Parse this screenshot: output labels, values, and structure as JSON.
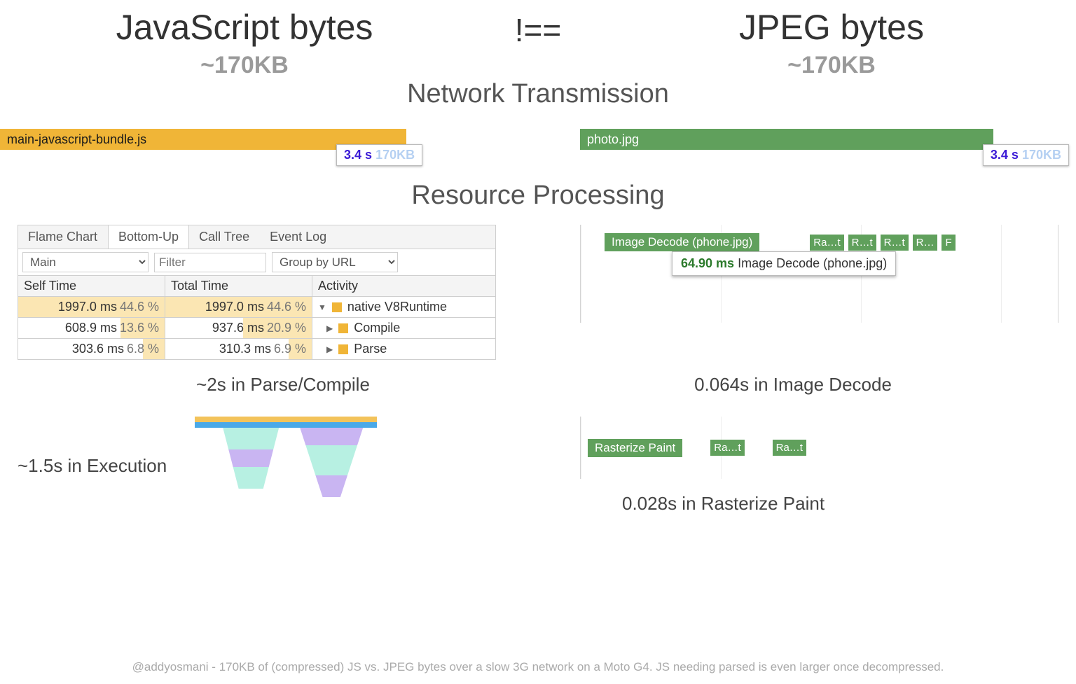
{
  "titles": {
    "left": "JavaScript bytes",
    "notequal": "!==",
    "right": "JPEG bytes",
    "size_left": "~170KB",
    "size_right": "~170KB"
  },
  "sections": {
    "network": "Network Transmission",
    "processing": "Resource Processing"
  },
  "network": {
    "left_file": "main-javascript-bundle.js",
    "right_file": "photo.jpg",
    "badge_left": {
      "time": "3.4 s",
      "size": "170KB"
    },
    "badge_right": {
      "time": "3.4 s",
      "size": "170KB"
    }
  },
  "bottom_up": {
    "tabs": [
      "Flame Chart",
      "Bottom-Up",
      "Call Tree",
      "Event Log"
    ],
    "active_tab": "Bottom-Up",
    "main_select": "Main",
    "filter_placeholder": "Filter",
    "group_by": "Group by URL",
    "columns": [
      "Self Time",
      "Total Time",
      "Activity"
    ],
    "rows": [
      {
        "self_ms": "1997.0 ms",
        "self_pct": "44.6 %",
        "self_bar": 100,
        "total_ms": "1997.0 ms",
        "total_pct": "44.6 %",
        "total_bar": 100,
        "tri": "▼",
        "activity": "native V8Runtime"
      },
      {
        "self_ms": "608.9 ms",
        "self_pct": "13.6 %",
        "self_bar": 30,
        "total_ms": "937.6 ms",
        "total_pct": "20.9 %",
        "total_bar": 47,
        "tri": "▶",
        "activity": "Compile"
      },
      {
        "self_ms": "303.6 ms",
        "self_pct": "6.8 %",
        "self_bar": 15,
        "total_ms": "310.3 ms",
        "total_pct": "6.9 %",
        "total_bar": 16,
        "tri": "▶",
        "activity": "Parse"
      }
    ]
  },
  "image_decode": {
    "main_seg": "Image Decode (phone.jpg)",
    "tooltip_ms": "64.90 ms",
    "tooltip_label": "Image Decode (phone.jpg)",
    "small_segs": [
      "Ra…t",
      "R…t",
      "R…t",
      "R…",
      "F"
    ]
  },
  "summaries": {
    "left": "~2s in Parse/Compile",
    "right": "0.064s in Image Decode"
  },
  "exec": {
    "label": "~1.5s in Execution"
  },
  "raster": {
    "segs": [
      "Rasterize Paint",
      "Ra…t",
      "Ra…t"
    ],
    "summary": "0.028s in Rasterize Paint"
  },
  "footer": "@addyosmani - 170KB of (compressed) JS vs. JPEG bytes over a slow 3G network on a Moto G4. JS needing parsed is even larger once decompressed."
}
